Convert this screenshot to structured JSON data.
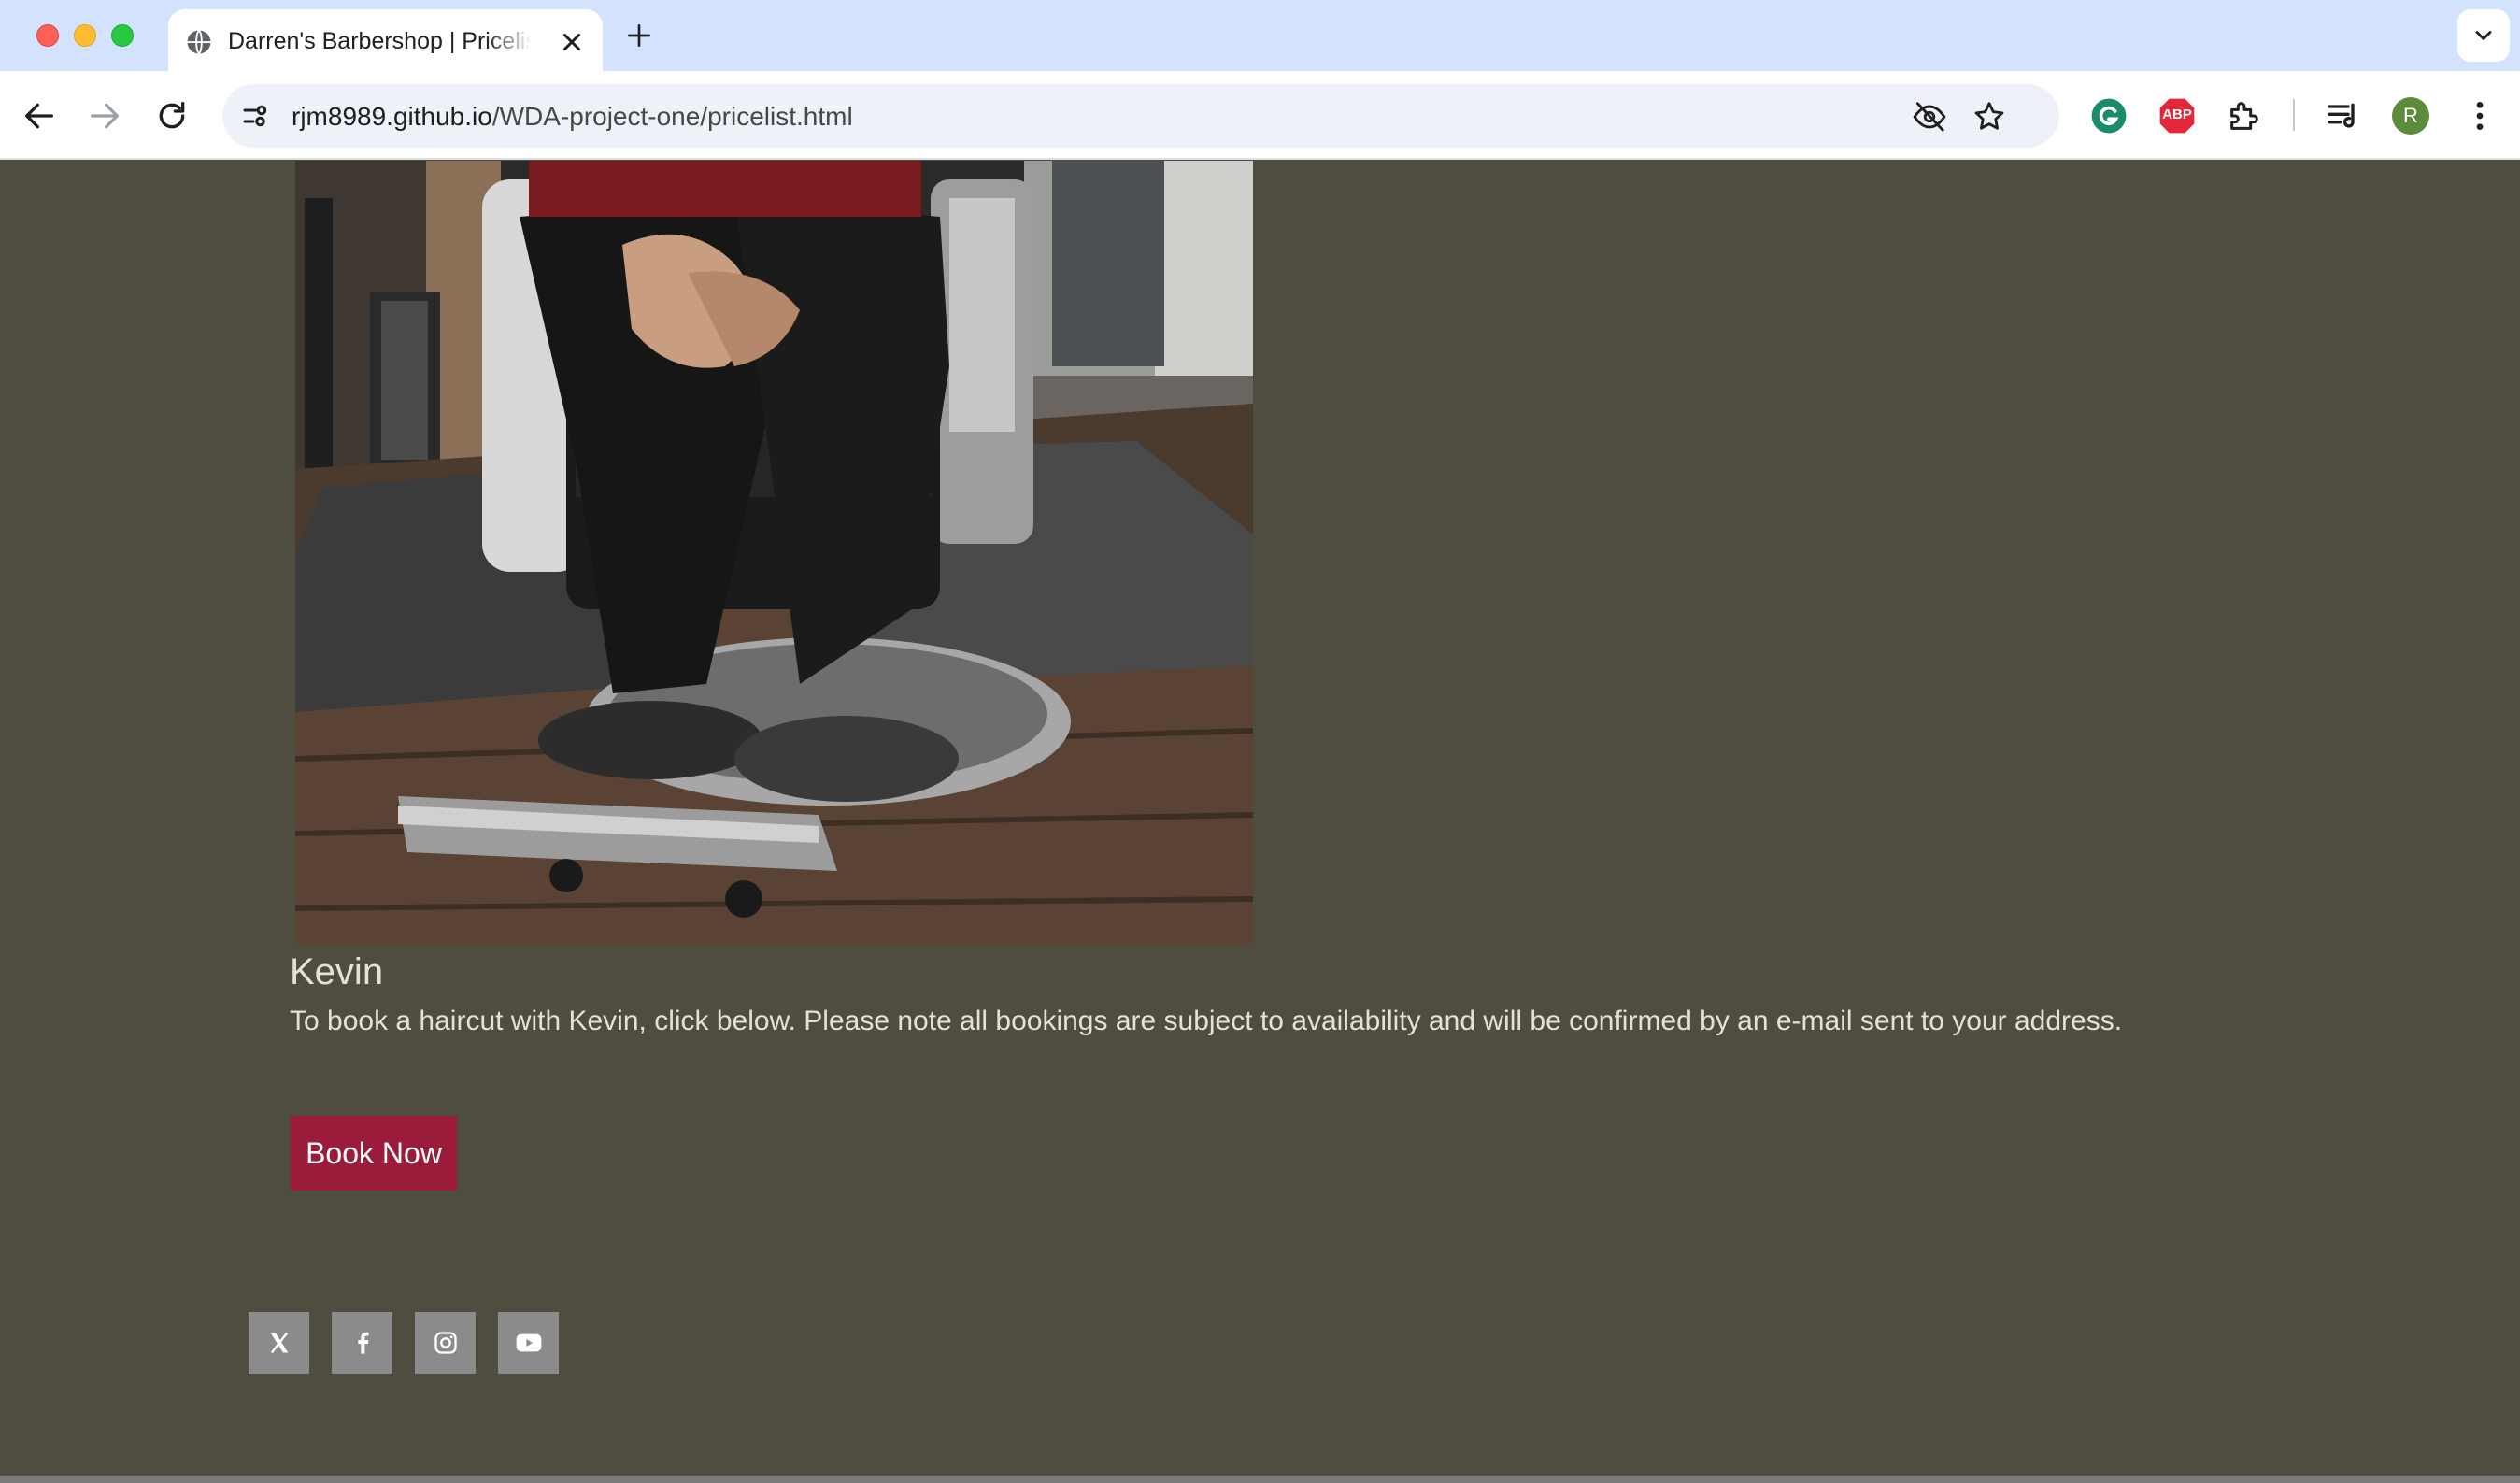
{
  "browser": {
    "tab_title": "Darren's Barbershop | Pricelist",
    "url_host": "rjm8989.github.io",
    "url_path": "/WDA-project-one/pricelist.html",
    "profile_initial": "R",
    "extension_badge": "ABP"
  },
  "barber": {
    "photo_alt": "Barber sitting in barbershop chair",
    "name": "Kevin",
    "description": "To book a haircut with Kevin, click below. Please note all bookings are subject to availability and will be confirmed by an e-mail sent to your address.",
    "book_label": "Book Now"
  },
  "footer": {
    "social_links": [
      {
        "name": "x-twitter-icon"
      },
      {
        "name": "facebook-icon"
      },
      {
        "name": "instagram-icon"
      },
      {
        "name": "youtube-icon"
      }
    ]
  },
  "colors": {
    "page_bg": "#4f4c40",
    "text": "#e6e1d6",
    "book_button": "#9b1c3a",
    "social_bg": "#8b8b8b",
    "tabstrip": "#d3e3fd"
  }
}
